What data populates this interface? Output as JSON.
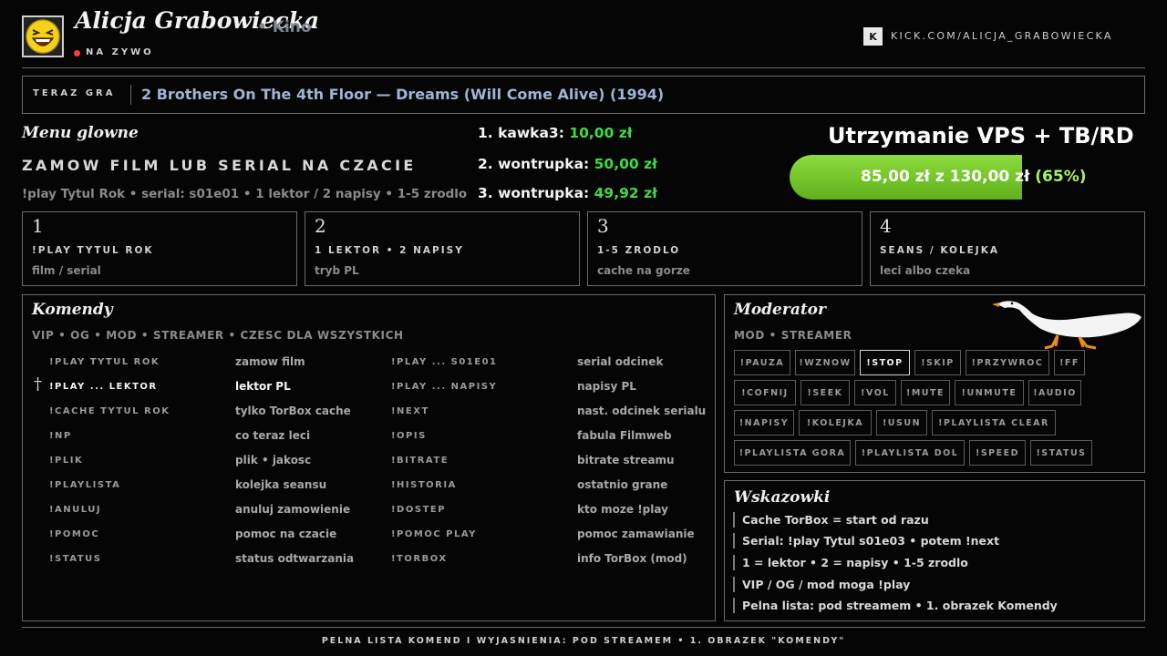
{
  "header": {
    "streamer_name": "Alicja Grabowiecka",
    "category": "• Kino",
    "live_label": "NA ZYWO",
    "kick_logo": "K",
    "kick_url": "KICK.COM/ALICJA_GRABOWIECKA",
    "avatar_icon": "laughing-face-icon"
  },
  "now_playing": {
    "label": "TERAZ GRA",
    "title": "2 Brothers On The 4th Floor — Dreams (Will Come Alive) (1994)"
  },
  "menu": {
    "title": "Menu glowne",
    "caption": "ZAMOW FILM LUB SERIAL NA CZACIE",
    "syntax_hint": "!play Tytul Rok • serial: s01e01 • 1 lektor / 2 napisy • 1-5 zrodlo"
  },
  "donors": [
    {
      "rank_name": "1. kawka3:",
      "amount": "10,00 zł"
    },
    {
      "rank_name": "2. wontrupka:",
      "amount": "50,00 zł"
    },
    {
      "rank_name": "3. wontrupka:",
      "amount": "49,92 zł"
    }
  ],
  "goal": {
    "title": "Utrzymanie VPS + TB/RD",
    "text": "85,00 zł z 130,00 zł",
    "percent_label": "(65%)",
    "progress": 0.65,
    "fill_color": "#6cc228"
  },
  "steps": [
    {
      "num": "1",
      "title": "!PLAY TYTUL ROK",
      "sub": "film / serial"
    },
    {
      "num": "2",
      "title": "1 LEKTOR • 2 NAPISY",
      "sub": "tryb PL"
    },
    {
      "num": "3",
      "title": "1-5 ZRODLO",
      "sub": "cache na gorze"
    },
    {
      "num": "4",
      "title": "SEANS / KOLEJKA",
      "sub": "leci albo czeka"
    }
  ],
  "commands": {
    "title": "Komendy",
    "roles": "VIP • OG • MOD • STREAMER • CZESC DLA WSZYSTKICH",
    "marker": "†",
    "rows": [
      {
        "c1": "!PLAY TYTUL ROK",
        "d1": "zamow film",
        "c2": "!PLAY ... S01E01",
        "d2": "serial odcinek"
      },
      {
        "c1": "!PLAY ... LEKTOR",
        "d1": "lektor PL",
        "c2": "!PLAY ... NAPISY",
        "d2": "napisy PL"
      },
      {
        "c1": "!CACHE TYTUL ROK",
        "d1": "tylko TorBox cache",
        "c2": "!NEXT",
        "d2": "nast. odcinek serialu"
      },
      {
        "c1": "!NP",
        "d1": "co teraz leci",
        "c2": "!OPIS",
        "d2": "fabula Filmweb"
      },
      {
        "c1": "!PLIK",
        "d1": "plik • jakosc",
        "c2": "!BITRATE",
        "d2": "bitrate streamu"
      },
      {
        "c1": "!PLAYLISTA",
        "d1": "kolejka seansu",
        "c2": "!HISTORIA",
        "d2": "ostatnio grane"
      },
      {
        "c1": "!ANULUJ",
        "d1": "anuluj zamowienie",
        "c2": "!DOSTEP",
        "d2": "kto moze !play"
      },
      {
        "c1": "!POMOC",
        "d1": "pomoc na czacie",
        "c2": "!POMOC PLAY",
        "d2": "pomoc zamawianie"
      },
      {
        "c1": "!STATUS",
        "d1": "status odtwarzania",
        "c2": "!TORBOX",
        "d2": "info TorBox (mod)"
      }
    ]
  },
  "moderator": {
    "title": "Moderator",
    "roles": "MOD • STREAMER",
    "goose_icon": "goose-icon",
    "buttons": [
      [
        "!PAUZA",
        "!WZNOW",
        "!STOP",
        "!SKIP",
        "!PRZYWROC",
        "!FF"
      ],
      [
        "!COFNIJ",
        "!SEEK",
        "!VOL",
        "!MUTE",
        "!UNMUTE",
        "!AUDIO"
      ],
      [
        "!NAPISY",
        "!KOLEJKA",
        "!USUN",
        "!PLAYLISTA CLEAR"
      ],
      [
        "!PLAYLISTA GORA",
        "!PLAYLISTA DOL",
        "!SPEED",
        "!STATUS"
      ]
    ],
    "active_button": "!STOP"
  },
  "tips": {
    "title": "Wskazowki",
    "items": [
      "Cache TorBox = start od razu",
      "Serial: !play Tytul s01e03 • potem !next",
      "1 = lektor • 2 = napisy • 1-5 zrodlo",
      "VIP / OG / mod moga !play",
      "Pelna lista: pod streamem • 1. obrazek Komendy"
    ]
  },
  "footer": {
    "text": "PELNA LISTA KOMEND I WYJASNIENIA: POD STREAMEM • 1. OBRAZEK \"KOMENDY\""
  }
}
